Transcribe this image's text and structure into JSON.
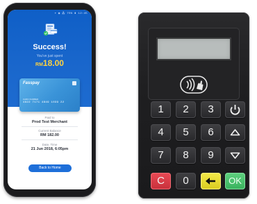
{
  "phone": {
    "status_bar": "▾ ◉ ⁂ 75% ▮ 12:45",
    "title": "Success!",
    "spent_label": "You've just spent",
    "currency": "RM",
    "amount": "18.00",
    "card": {
      "brand": "Fasspay",
      "caption": "CARD NUMBER",
      "number": "4822 7171 4849 1039 22"
    },
    "details": [
      {
        "label": "Paid to",
        "value": "Prod Test Merchant"
      },
      {
        "label": "Current Balance",
        "value": "RM 182.00"
      },
      {
        "label": "Date, Time",
        "value": "21 Jun 2018, 6:05pm"
      }
    ],
    "home_button": "Back to Home"
  },
  "pinpad": {
    "keys": [
      "1",
      "2",
      "3",
      "4",
      "5",
      "6",
      "7",
      "8",
      "9",
      "0"
    ],
    "cancel_key": "C",
    "ok_key": "OK",
    "colors": {
      "cancel": "#d63a45",
      "clear": "#e8dc2f",
      "ok": "#4cc26f",
      "body": "#1f1f21",
      "lcd": "#b8bdbc"
    },
    "icons": {
      "power": "power-icon",
      "up": "up-arrow-icon",
      "down": "down-arrow-icon",
      "clear": "left-arrow-icon",
      "contactless": "contactless-icon"
    }
  }
}
